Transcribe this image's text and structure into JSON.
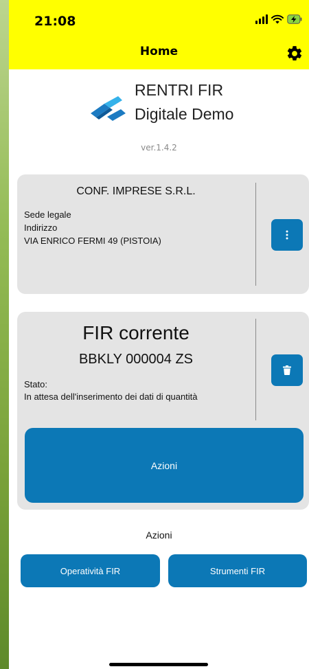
{
  "status_bar": {
    "time": "21:08",
    "icons": [
      "signal-icon",
      "wifi-icon",
      "battery-charging-icon"
    ]
  },
  "header": {
    "title": "Home",
    "settings_icon": "gear-icon",
    "background": "#ffff00"
  },
  "brand": {
    "line1": "RENTRI FIR",
    "line2": "Digitale Demo",
    "version": "ver.1.4.2",
    "logo_icon": "rentri-logo-icon"
  },
  "company": {
    "name": "CONF. IMPRESE S.R.L.",
    "line1": "Sede legale",
    "line2": "Indirizzo",
    "line3": "VIA ENRICO FERMI 49 (PISTOIA)",
    "menu_icon": "more-vertical-icon"
  },
  "fir": {
    "title": "FIR corrente",
    "code": "BBKLY 000004 ZS",
    "status_label": "Stato:",
    "status_value": "In attesa dell'inserimento dei dati di quantità",
    "delete_icon": "trash-icon",
    "actions_button": "Azioni"
  },
  "actions": {
    "label": "Azioni",
    "operativita": "Operatività FIR",
    "strumenti": "Strumenti FIR"
  },
  "colors": {
    "accent": "#0c78b6",
    "card": "#e4e4e4"
  }
}
